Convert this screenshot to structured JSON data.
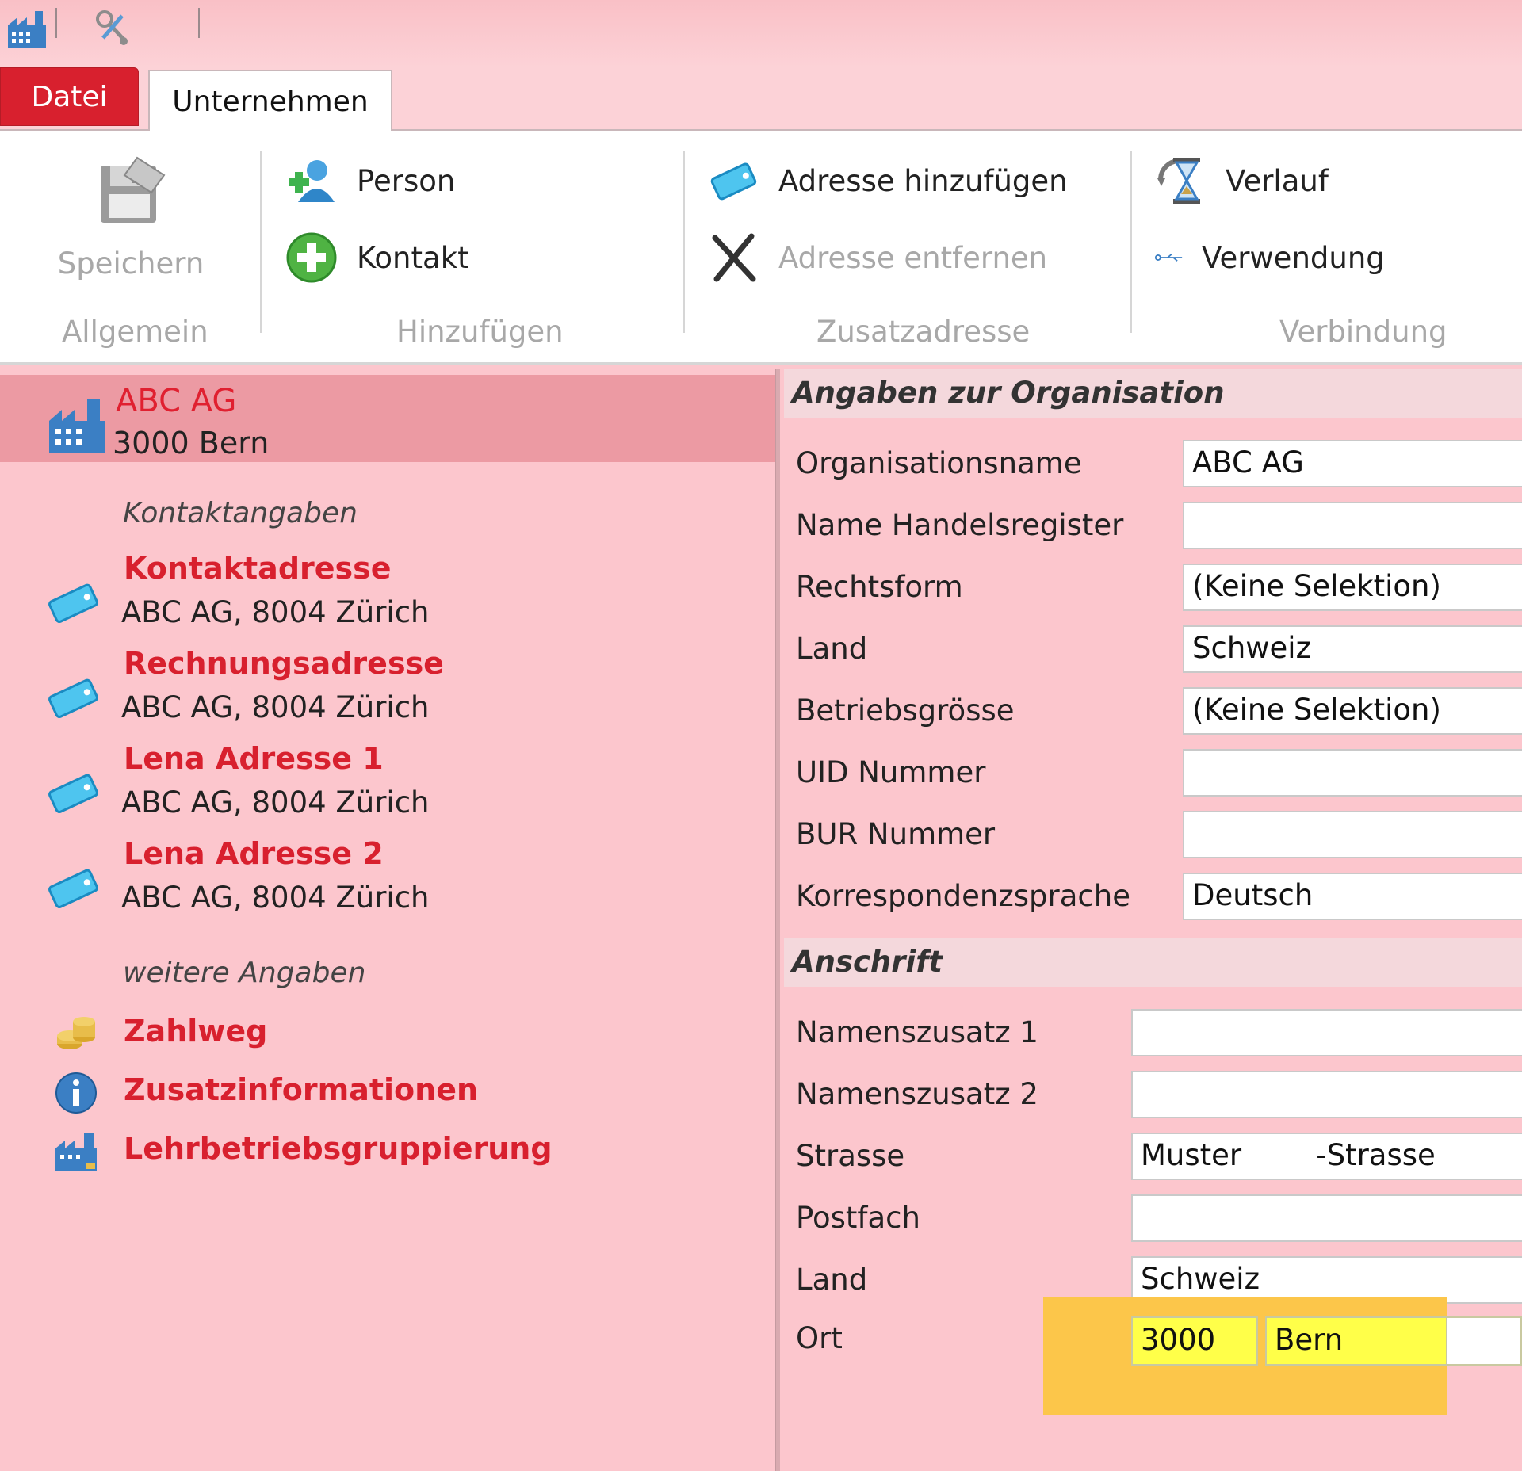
{
  "quick_access": {
    "icons": [
      "factory-icon",
      "tools-icon"
    ]
  },
  "tabs": {
    "file": "Datei",
    "active": "Unternehmen"
  },
  "ribbon": {
    "save": "Speichern",
    "group_general": "Allgemein",
    "person": "Person",
    "contact": "Kontakt",
    "group_add": "Hinzufügen",
    "add_address": "Adresse hinzufügen",
    "remove_address": "Adresse entfernen",
    "group_extra_address": "Zusatzadresse",
    "history": "Verlauf",
    "usage": "Verwendung",
    "group_connection": "Verbindung"
  },
  "left": {
    "selected": {
      "title": "ABC  AG",
      "subtitle": "3000 Bern"
    },
    "section_contact": "Kontaktangaben",
    "addresses": [
      {
        "title": "Kontaktadresse",
        "subtitle": "ABC AG, 8004 Zürich"
      },
      {
        "title": "Rechnungsadresse",
        "subtitle": "ABC  AG, 8004 Zürich"
      },
      {
        "title": "Lena Adresse 1",
        "subtitle": "ABC  AG, 8004 Zürich"
      },
      {
        "title": "Lena Adresse 2",
        "subtitle": "ABC  AG, 8004 Zürich"
      }
    ],
    "section_more": "weitere Angaben",
    "more": [
      {
        "title": "Zahlweg",
        "icon": "coins-icon"
      },
      {
        "title": "Zusatzinformationen",
        "icon": "info-icon"
      },
      {
        "title": "Lehrbetriebsgruppierung",
        "icon": "factory-icon"
      }
    ]
  },
  "right": {
    "section_org": "Angaben zur Organisation",
    "org_fields": [
      {
        "label": "Organisationsname",
        "value": "ABC AG"
      },
      {
        "label": "Name Handelsregister",
        "value": ""
      },
      {
        "label": "Rechtsform",
        "value": "(Keine Selektion)"
      },
      {
        "label": "Land",
        "value": "Schweiz"
      },
      {
        "label": "Betriebsgrösse",
        "value": "(Keine Selektion)"
      },
      {
        "label": "UID Nummer",
        "value": ""
      },
      {
        "label": "BUR Nummer",
        "value": ""
      },
      {
        "label": "Korrespondenzsprache",
        "value": "Deutsch"
      }
    ],
    "section_address": "Anschrift",
    "address_fields": [
      {
        "label": "Namenszusatz 1",
        "value": ""
      },
      {
        "label": "Namenszusatz 2",
        "value": ""
      },
      {
        "label": "Strasse",
        "value": "Muster        -Strasse"
      },
      {
        "label": "Postfach",
        "value": ""
      },
      {
        "label": "Land",
        "value": "Schweiz"
      }
    ],
    "city": {
      "label": "Ort",
      "zip": "3000",
      "name": "Bern"
    }
  },
  "colors": {
    "background": "#fcc6cd",
    "accent_red": "#d8202e",
    "selection": "#ec9aa3",
    "highlight": "#fcc64a",
    "highlight_field": "#ffff49"
  }
}
